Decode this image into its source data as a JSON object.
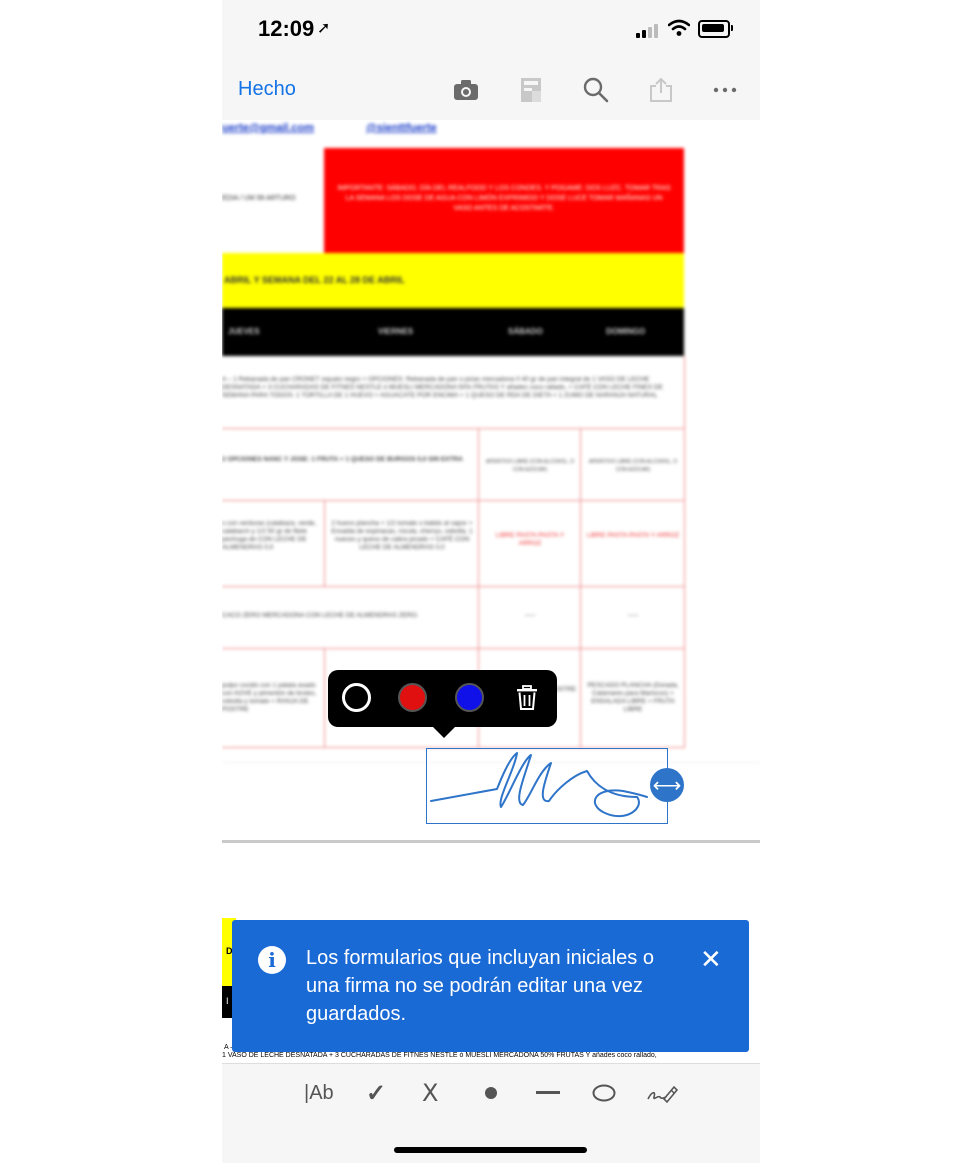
{
  "status_bar": {
    "time": "12:09",
    "location_glyph": "➚"
  },
  "toolbar": {
    "done_label": "Hecho",
    "icons": [
      "camera-icon",
      "document-icon",
      "search-icon",
      "share-icon",
      "more-icon"
    ]
  },
  "document": {
    "email": "uerte@gmail.com",
    "handle": "@sienttfuerte",
    "left_text": "EDIA / UM 99 ARTURO",
    "red_box_text": "IMPORTANTE: SÁBADO, DÍA DEL REALFOOD Y LOS CONDES. Y POGAME: DOS LUZC. TOMAR TRAS LA SEMANA LOS DOSE DE AGUA CON LIMÓN EXPRIMIDO Y  DOSE LUCE TOMAR MAÑANAS UN VASO ANTES DE ACOSTARTE.",
    "yellow_text": "ABRIL  Y SEMANA DEL 22 AL 28 DE ABRIL",
    "day_headers": [
      "JUEVES",
      "VIERNES",
      "SÁBADO",
      "DOMINGO"
    ],
    "rows": [
      {
        "text": "A – 1 Rebanada de pan CRONET siquato negro + OPCIONES: Rebanada de pan o pizas mercadona 0 40 gr de pan integral de 1 VASO DE LECHE DESNATADA + 3 CUCHARADAS DE FITNES NESTLE ó MUESLI MERCADONA 50% FRUTAS Y añades coco rallado, + CAFÉ CON LECHE FINES DE SEMANA PARA TODOS: 1 TORTILLA DE 1 HUEVO + AGUACATE POR ENCIMA + 1 QUESO DE RDA DE DIETA + 1 ZUMO DE NARANJA NATURAL"
      },
      {
        "text": "2 OPCIONES NANC Y JOSE: 1 FRUTA + 1 QUESO DE BURGOS 0,0 SIN EXTRA",
        "sat": "APERITIVO LIBRE (CON ALCOHOL, O CON AZÚCAR)",
        "sun": "APERITIVO LIBRE (CON ALCOHOL, O CON AZÚCAR)"
      },
      {
        "text": "s con verduras (calabaza, verde, calabacín y 1/2 50 gr de filete pechuga de CON LECHE DE ALMENDRAS 0,0",
        "fri": "2 huevo plancha + 1/2 tomate o batido al vapor + Ensalda de espinacas, rúcula, cherrys, cebolla, 1 nueces y queso de cabra picado + CAFÉ CON LECHE DE ALMENDRAS 0,0",
        "sat": "LIBRE PASTA PASTA Y ARROZ",
        "sun": "LIBRE PASTA PASTA Y ARROZ"
      },
      {
        "text": "CACO ZERO MERCADONA CON LECHE DE ALMENDRAS ZERO.",
        "sat": "-----",
        "sun": "-----"
      },
      {
        "text": "pulpo cocido con 1 patata asado con AOVE y pimentón de brotes, cebolla y tomate + RANJA DE POSTRE",
        "sat": "POSTRE",
        "sun": "PESCADO PLANCHA (Dorada, Calamares para Mariscos) + ENSALADA LIBRE + FRUTA LIBRE"
      }
    ]
  },
  "color_popup": {
    "swatches": [
      "#000000",
      "#ff0000",
      "#0000ff"
    ],
    "delete_icon": "trash-icon"
  },
  "banner": {
    "message": "Los formularios que incluyan iniciales o una firma no se podrán editar una vez guardados.",
    "close_glyph": "✕"
  },
  "page2": {
    "fragment_top": "D",
    "fragment_mid": "I",
    "fragment_a": "A –",
    "line": "1 VASO DE LECHE DESNATADA + 3 CUCHARADAS DE FITNES NESTLE ó MUESLI MERCADONA 50% FRUTAS Y añades coco rallado,"
  },
  "bottom_tools": {
    "text_tool": "|Ab",
    "check": "✓",
    "cross": "X"
  }
}
